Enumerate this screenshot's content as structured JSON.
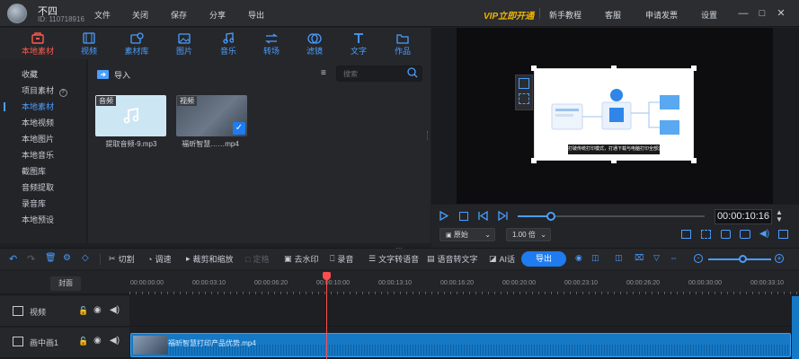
{
  "titlebar": {
    "username": "不四",
    "user_id": "ID: 110718916",
    "menus": [
      "文件",
      "关闭",
      "保存",
      "分享",
      "导出"
    ],
    "vip": "VIP立即开通",
    "right_menus": [
      "新手教程",
      "客服",
      "申请发票",
      "设置"
    ]
  },
  "tabs": [
    {
      "label": "本地素材",
      "icon": "box-icon",
      "active": true
    },
    {
      "label": "视频",
      "icon": "film-icon"
    },
    {
      "label": "素材库",
      "icon": "library-icon"
    },
    {
      "label": "图片",
      "icon": "image-icon"
    },
    {
      "label": "音乐",
      "icon": "music-icon"
    },
    {
      "label": "转场",
      "icon": "transition-icon"
    },
    {
      "label": "滤镜",
      "icon": "filter-icon"
    },
    {
      "label": "文字",
      "icon": "text-icon"
    },
    {
      "label": "作品",
      "icon": "folder-icon"
    }
  ],
  "sidebar": {
    "items": [
      "收藏",
      "项目素材",
      "本地素材",
      "本地视频",
      "本地图片",
      "本地音乐",
      "截图库",
      "音频提取",
      "录音库",
      "本地预设"
    ],
    "active_index": 2
  },
  "media": {
    "import_label": "导入",
    "search_placeholder": "搜索",
    "items": [
      {
        "tag": "音频",
        "name": "提取音频-9.mp3"
      },
      {
        "tag": "视频",
        "name": "福昕智慧……mp4"
      }
    ]
  },
  "preview": {
    "image_caption": "打破传统打印模式，打通下载与电脑打印全部流",
    "timecode": "00:00:10:16",
    "ratio": "原始",
    "speed": "1.00 倍"
  },
  "toolbar": {
    "cut": "切割",
    "speed": "调速",
    "crop": "裁剪和缩放",
    "freeze": "定格",
    "watermark": "去水印",
    "record": "录音",
    "tts": "文字转语音",
    "stt": "语音转文字",
    "ai": "AI话",
    "export": "导出"
  },
  "timeline": {
    "cover": "封面",
    "ticks": [
      "00:00:00:00",
      "00:00:03:10",
      "00:00:06:20",
      "00:00:10:00",
      "00:00:13:10",
      "00:00:16:20",
      "00:00:20:00",
      "00:00:23:10",
      "00:00:26:20",
      "00:00:30:00",
      "00:00:33:10"
    ],
    "tracks": [
      {
        "label": "视频"
      },
      {
        "label": "画中画1"
      }
    ],
    "clip_label": "福昕智慧打印产品优势.mp4"
  },
  "colors": {
    "accent": "#1e7bf0",
    "active_tab": "#ff5a4e",
    "vip": "#f0b400",
    "clip": "#1579c6",
    "playhead": "#ff4d4d"
  }
}
